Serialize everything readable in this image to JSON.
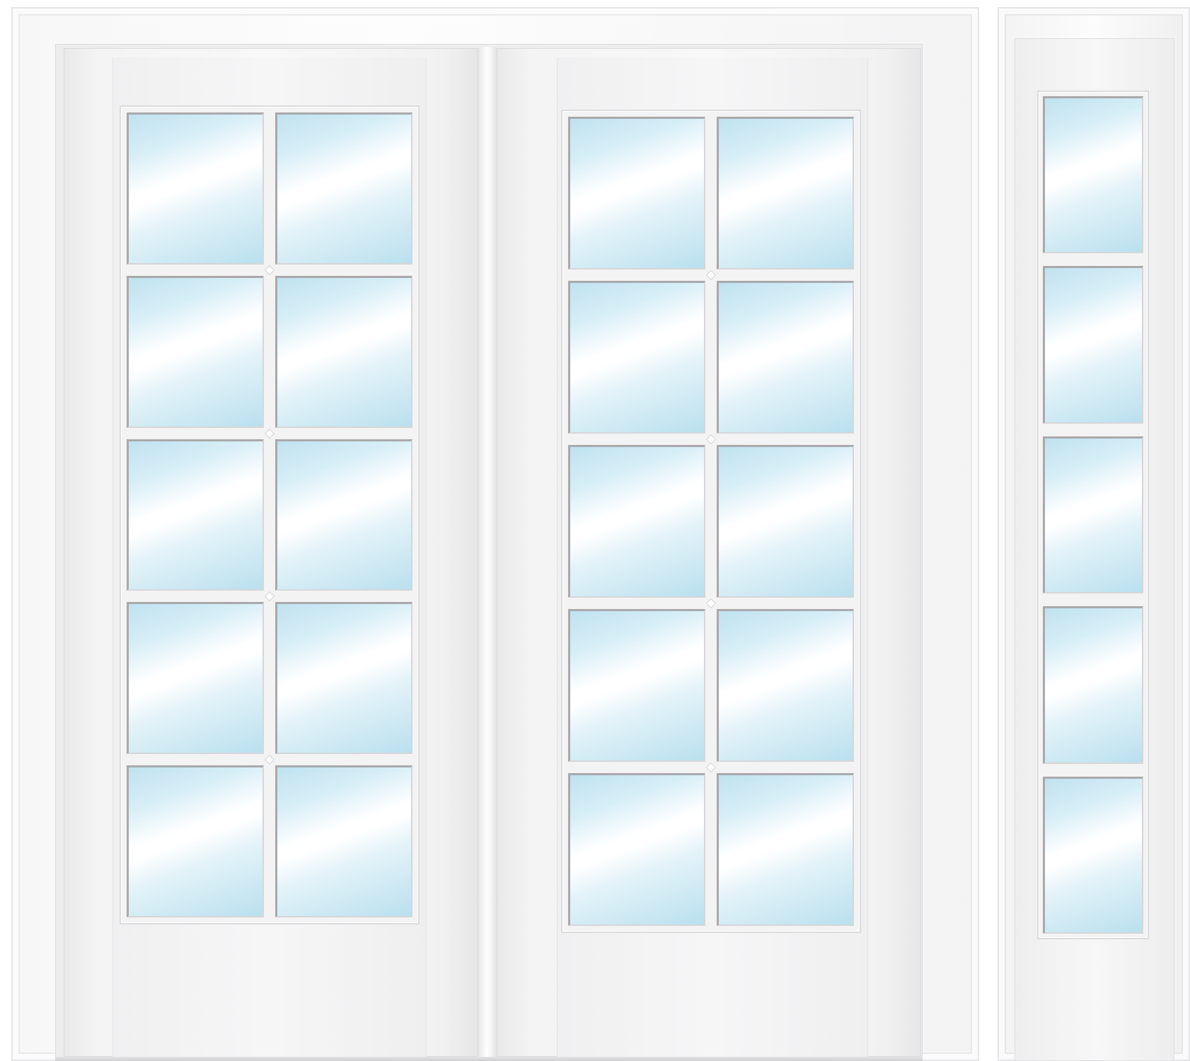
{
  "scene": {
    "subject": "double-door-with-sidelite",
    "colors": {
      "frame": "#f7f7f8",
      "door": "#f4f4f5",
      "glass_light": "#ffffff",
      "glass_tint": "#b9e0ee",
      "pane_edge": "#a9a9ab"
    },
    "doors": [
      {
        "id": "left-door",
        "pane_rows": 5,
        "pane_cols": 2
      },
      {
        "id": "right-door",
        "pane_rows": 5,
        "pane_cols": 2
      }
    ],
    "sidelite": {
      "id": "right-sidelite",
      "pane_rows": 5,
      "pane_cols": 1
    }
  }
}
